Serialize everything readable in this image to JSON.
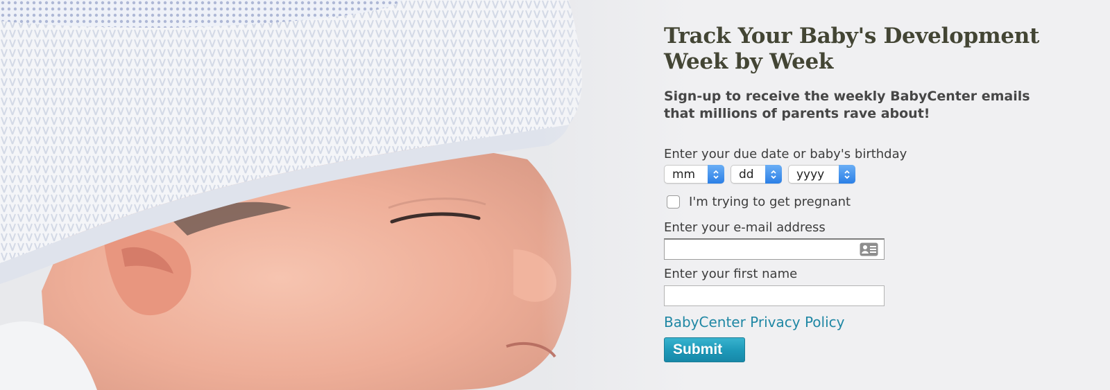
{
  "hero": {
    "image_alt": "sleeping baby in white knit hat"
  },
  "signup": {
    "headline_line1": "Track Your Baby's Development",
    "headline_line2": "Week by Week",
    "subhead_line1": "Sign-up to receive the weekly BabyCenter emails",
    "subhead_line2": "that millions of parents rave about!",
    "due_date_label": "Enter your due date or baby's birthday",
    "month_select": "mm",
    "day_select": "dd",
    "year_select": "yyyy",
    "trying_label": "I'm trying to get pregnant",
    "email_label": "Enter your e-mail address",
    "email_value": "",
    "name_label": "Enter your first name",
    "name_value": "",
    "privacy_link": "BabyCenter Privacy Policy",
    "submit_label": "Submit"
  },
  "colors": {
    "headline": "#434534",
    "link": "#1f87a4",
    "submit": "#1d98b8",
    "background": "#f0f0f2"
  }
}
